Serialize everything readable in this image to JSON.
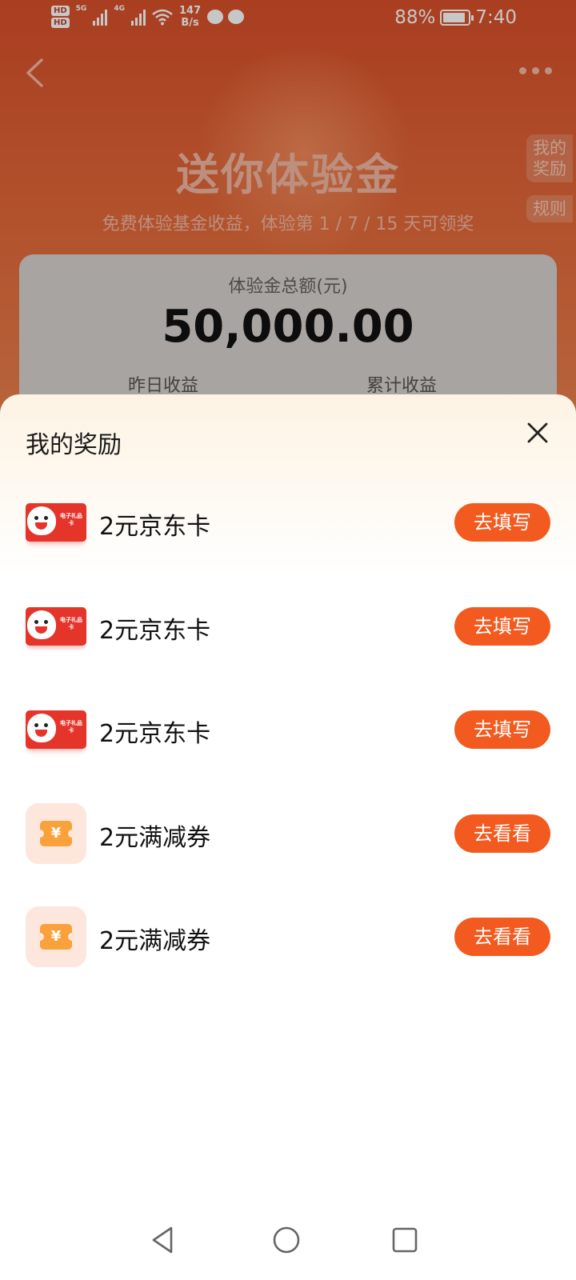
{
  "status_bar": {
    "hd_labels": [
      "HD",
      "HD"
    ],
    "network_1": "5G",
    "network_2": "4G",
    "speed_value": "147",
    "speed_unit": "B/s",
    "battery": "88%",
    "time": "7:40"
  },
  "background": {
    "title": "送你体验金",
    "subtitle": "免费体验基金收益，体验第 1 / 7 / 15 天可领奖",
    "side_rewards": "我的奖励",
    "side_rules": "规则",
    "card": {
      "total_label": "体验金总额(元)",
      "total_amount": "50,000.00",
      "yesterday_label": "昨日收益",
      "cumulative_label": "累计收益"
    }
  },
  "sheet": {
    "title": "我的奖励",
    "rewards": [
      {
        "name": "2元京东卡",
        "button": "去填写",
        "icon": "jd-gift-card-icon",
        "card_text": "电子礼品卡"
      },
      {
        "name": "2元京东卡",
        "button": "去填写",
        "icon": "jd-gift-card-icon",
        "card_text": "电子礼品卡"
      },
      {
        "name": "2元京东卡",
        "button": "去填写",
        "icon": "jd-gift-card-icon",
        "card_text": "电子礼品卡"
      },
      {
        "name": "2元满减券",
        "button": "去看看",
        "icon": "coupon-icon",
        "coupon_symbol": "¥"
      },
      {
        "name": "2元满减券",
        "button": "去看看",
        "icon": "coupon-icon",
        "coupon_symbol": "¥"
      }
    ]
  },
  "colors": {
    "accent": "#f25a1f",
    "sheet_top": "#fdf3e3",
    "header_bg": "#d9502a"
  }
}
